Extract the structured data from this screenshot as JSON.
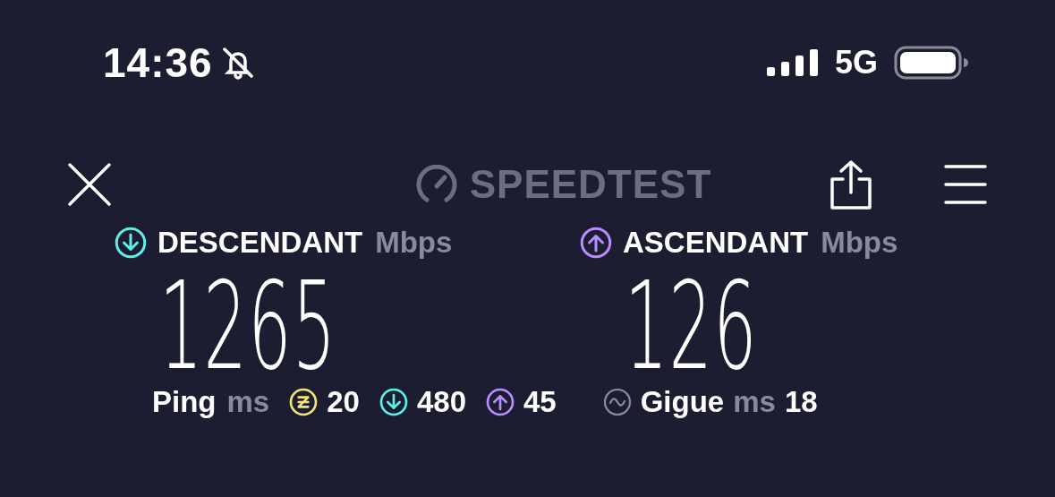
{
  "status_bar": {
    "time": "14:36",
    "silent": true,
    "network": "5G"
  },
  "header": {
    "logo": "SPEEDTEST"
  },
  "results": [
    {
      "kind": "download",
      "label": "DESCENDANT",
      "unit": "Mbps",
      "value": "1265"
    },
    {
      "kind": "upload",
      "label": "ASCENDANT",
      "unit": "Mbps",
      "value": "126"
    }
  ],
  "ping": {
    "label": "Ping",
    "unit": "ms",
    "values": [
      {
        "kind": "idle",
        "value": "20"
      },
      {
        "kind": "download",
        "value": "480"
      },
      {
        "kind": "upload",
        "value": "45"
      }
    ]
  },
  "jitter": {
    "label": "Gigue",
    "unit": "ms",
    "value": "18"
  }
}
